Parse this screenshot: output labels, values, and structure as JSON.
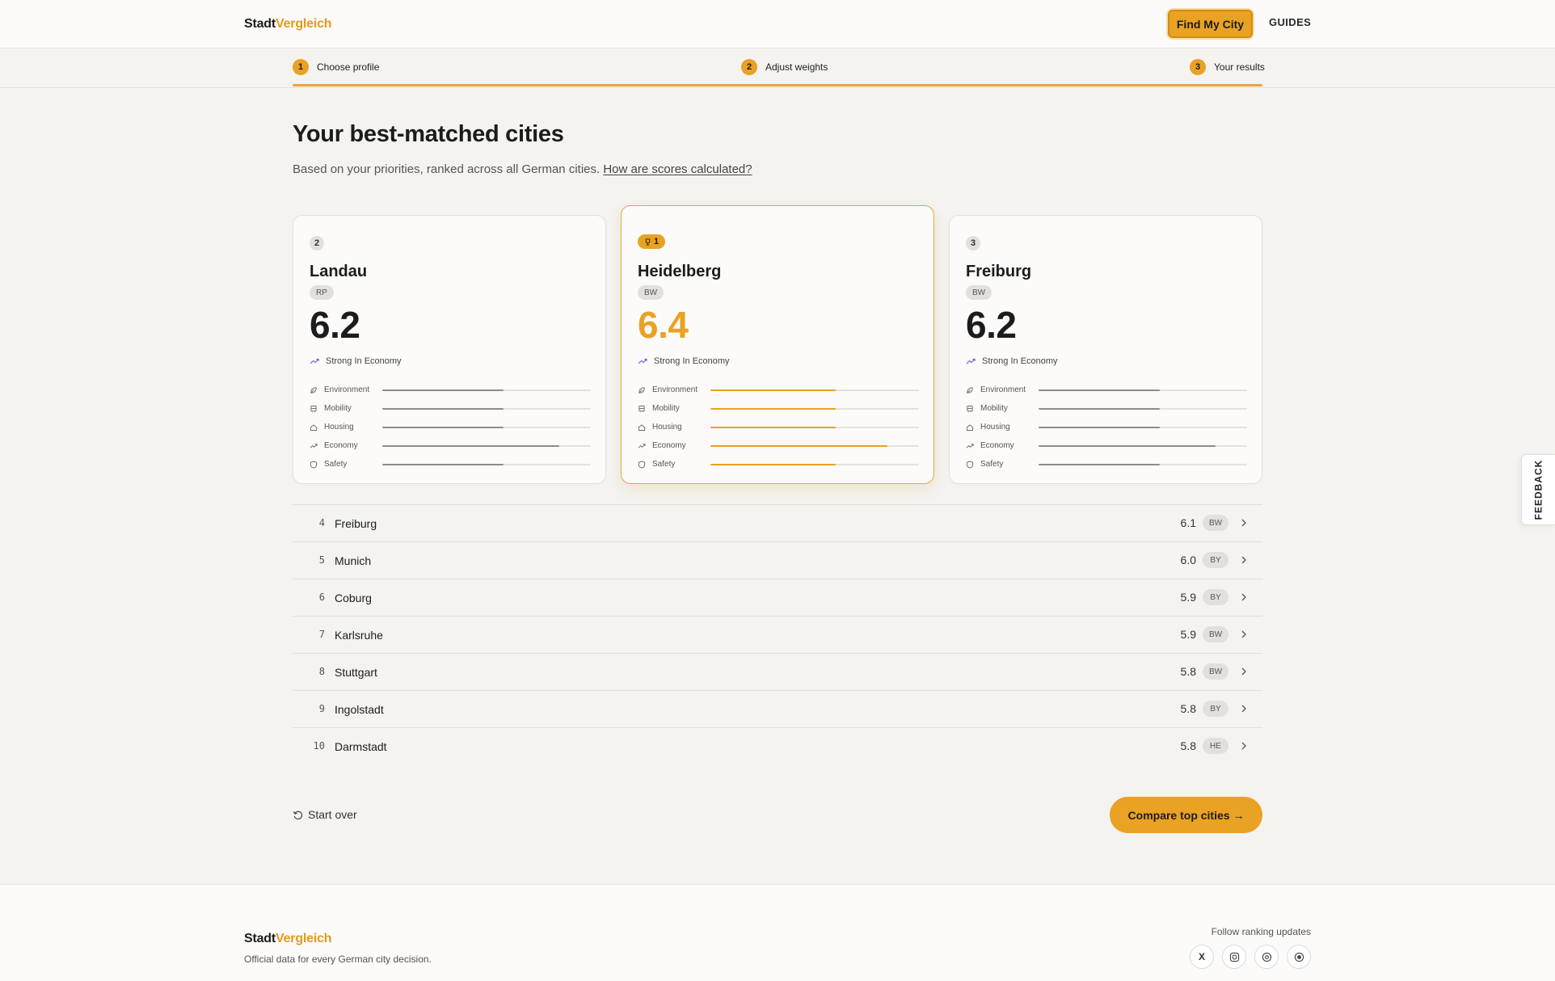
{
  "header": {
    "logo_part1": "Stadt",
    "logo_part2": "Vergleich",
    "find_button": "Find My City",
    "guides": "GUIDES"
  },
  "steps": [
    {
      "num": "1",
      "label": "Choose profile"
    },
    {
      "num": "2",
      "label": "Adjust weights"
    },
    {
      "num": "3",
      "label": "Your results"
    }
  ],
  "main": {
    "title": "Your best-matched cities",
    "subtitle": "Based on your priorities, ranked across all German cities.",
    "subtitle_link": "How are scores calculated?"
  },
  "top_cards": [
    {
      "rank": "2",
      "city": "Landau",
      "state": "RP",
      "score": "6.2",
      "strength": "Strong In Economy",
      "metrics": [
        {
          "label": "Environment",
          "icon": "leaf-icon",
          "level": 0.58
        },
        {
          "label": "Mobility",
          "icon": "bus-icon",
          "level": 0.58
        },
        {
          "label": "Housing",
          "icon": "home-icon",
          "level": 0.58
        },
        {
          "label": "Economy",
          "icon": "trend-icon",
          "level": 0.85
        },
        {
          "label": "Safety",
          "icon": "shield-icon",
          "level": 0.58
        }
      ]
    },
    {
      "rank": "1",
      "city": "Heidelberg",
      "state": "BW",
      "score": "6.4",
      "strength": "Strong In Economy",
      "metrics": [
        {
          "label": "Environment",
          "icon": "leaf-icon",
          "level": 0.6
        },
        {
          "label": "Mobility",
          "icon": "bus-icon",
          "level": 0.6
        },
        {
          "label": "Housing",
          "icon": "home-icon",
          "level": 0.6
        },
        {
          "label": "Economy",
          "icon": "trend-icon",
          "level": 0.85
        },
        {
          "label": "Safety",
          "icon": "shield-icon",
          "level": 0.6
        }
      ]
    },
    {
      "rank": "3",
      "city": "Freiburg",
      "state": "BW",
      "score": "6.2",
      "strength": "Strong In Economy",
      "metrics": [
        {
          "label": "Environment",
          "icon": "leaf-icon",
          "level": 0.58
        },
        {
          "label": "Mobility",
          "icon": "bus-icon",
          "level": 0.58
        },
        {
          "label": "Housing",
          "icon": "home-icon",
          "level": 0.58
        },
        {
          "label": "Economy",
          "icon": "trend-icon",
          "level": 0.85
        },
        {
          "label": "Safety",
          "icon": "shield-icon",
          "level": 0.58
        }
      ]
    }
  ],
  "ranking": [
    {
      "rank": "4",
      "city": "Freiburg",
      "score": "6.1",
      "state": "BW"
    },
    {
      "rank": "5",
      "city": "Munich",
      "score": "6.0",
      "state": "BY"
    },
    {
      "rank": "6",
      "city": "Coburg",
      "score": "5.9",
      "state": "BY"
    },
    {
      "rank": "7",
      "city": "Karlsruhe",
      "score": "5.9",
      "state": "BW"
    },
    {
      "rank": "8",
      "city": "Stuttgart",
      "score": "5.8",
      "state": "BW"
    },
    {
      "rank": "9",
      "city": "Ingolstadt",
      "score": "5.8",
      "state": "BY"
    },
    {
      "rank": "10",
      "city": "Darmstadt",
      "score": "5.8",
      "state": "HE"
    }
  ],
  "actions": {
    "start_over": "Start over",
    "compare": "Compare top cities →"
  },
  "footer": {
    "logo_part1": "Stadt",
    "logo_part2": "Vergleich",
    "tagline": "Official data for every German city decision.",
    "follow": "Follow ranking updates",
    "socials": [
      {
        "icon": "x-icon",
        "label": "X"
      },
      {
        "icon": "instagram-icon",
        "label": ""
      },
      {
        "icon": "threads-icon",
        "label": ""
      },
      {
        "icon": "circle-icon",
        "label": ""
      }
    ]
  },
  "feedback": "FEEDBACK",
  "colors": {
    "accent": "#e9a224",
    "background": "#f4f3f0",
    "bar_neutral": "#8e8d8a"
  }
}
